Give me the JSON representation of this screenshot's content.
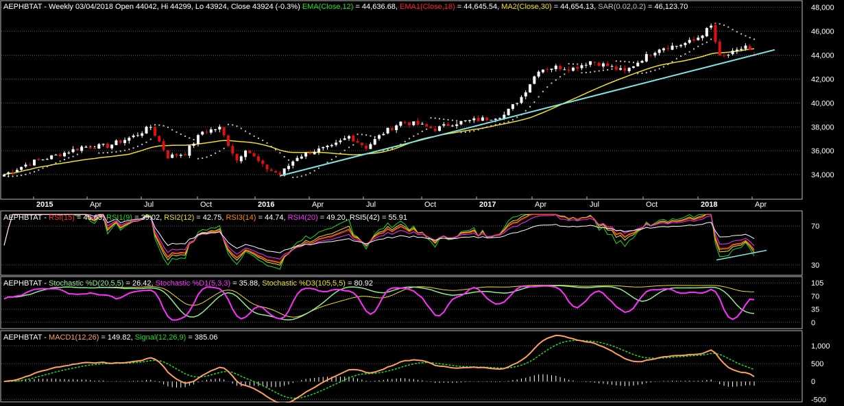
{
  "colors": {
    "background": "#000000",
    "border": "#bdbdbd",
    "grid": "#5a5a5a",
    "label": "#ffffff",
    "up_candle": "#ffffff",
    "down_candle": "#e01010",
    "ema": "#22dd22",
    "ema1": "#ff2020",
    "ma2": "#f0e020",
    "sar": "#c8c8c8",
    "trendline": "#7fe6e6",
    "rsi": "#ff3030",
    "rsi1": "#22dd22",
    "rsi2": "#f0e020",
    "rsi3": "#ff8c00",
    "rsi4": "#ff30ff",
    "rsi5": "#ffffff",
    "stoch_d": "#90ee90",
    "stoch_d1": "#ff30ff",
    "stoch_d3": "#f0e020",
    "macd": "#ffa060",
    "signal": "#22dd22",
    "histogram": "#ffffff"
  },
  "panels": {
    "price": {
      "symbol": "AEPHBTAT",
      "header_info": " - Weekly 03/04/2018 Open 44042, Hi 44299, Lo 43924, Close 43924 (-0.3%) ",
      "ind_ema_name": "EMA(Close,12)",
      "ind_ema_value": " = 44,636.68, ",
      "ind_ema1_name": "EMA1(Close,18)",
      "ind_ema1_value": " = 44,645.54, ",
      "ind_ma2_name": "MA2(Close,30)",
      "ind_ma2_value": " = 44,654.13, ",
      "ind_sar_name": "SAR(0.02,0.2)",
      "ind_sar_value": " = 46,123.70",
      "y_ticks": [
        "48,000",
        "46,000",
        "44,000",
        "42,000",
        "40,000",
        "38,000",
        "36,000",
        "34,000"
      ],
      "x_labels": [
        "2015",
        "Apr",
        "Jul",
        "Oct",
        "2016",
        "Apr",
        "Jul",
        "Oct",
        "2017",
        "Apr",
        "Jul",
        "Oct",
        "2018",
        "Apr"
      ]
    },
    "rsi": {
      "symbol": "AEPHBTAT",
      "sep": " - ",
      "ind_rsi_name": "RSI(15)",
      "ind_rsi_value": " = 45.63, ",
      "ind_rsi1_name": "RSI1(9)",
      "ind_rsi1_value": " = 39.02, ",
      "ind_rsi2_name": "RSI2(12)",
      "ind_rsi2_value": " = 42.75, ",
      "ind_rsi3_name": "RSI3(14)",
      "ind_rsi3_value": " = 44.74, ",
      "ind_rsi4_name": "RSI4(20)",
      "ind_rsi4_value": " = 49.20, ",
      "ind_rsi5_name": "RSI5(42)",
      "ind_rsi5_value": " = 55.91",
      "y_ticks": [
        "70",
        "30"
      ]
    },
    "stoch": {
      "symbol": "AEPHBTAT",
      "sep": " - ",
      "ind_d_name": "Stochastic %D(20,5,5)",
      "ind_d_value": " = 26.42, ",
      "ind_d1_name": "Stochastic %D1(5,3,3)",
      "ind_d1_value": " = 35.88, ",
      "ind_d3_name": "Stochastic %D3(105,5,5)",
      "ind_d3_value": " = 80.92",
      "y_ticks": [
        "105",
        "70",
        "35",
        "0"
      ]
    },
    "macd": {
      "symbol": "AEPHBTAT",
      "sep": " - ",
      "ind_macd_name": "MACD1(12,26)",
      "ind_macd_value": " = 149.82, ",
      "ind_signal_name": "Signal(12,26,9)",
      "ind_signal_value": " = 385.06",
      "y_ticks": [
        "1,000",
        "500",
        "0",
        "-500"
      ]
    }
  },
  "chart_data": [
    {
      "type": "candlestick",
      "title": "AEPHBTAT - Weekly",
      "ylim": [
        32000,
        48500
      ],
      "y_ticks": [
        34000,
        36000,
        38000,
        40000,
        42000,
        44000,
        46000,
        48000
      ],
      "x_labels": [
        "2015",
        "Apr",
        "Jul",
        "Oct",
        "2016",
        "Apr",
        "Jul",
        "Oct",
        "2017",
        "Apr",
        "Jul",
        "Oct",
        "2018",
        "Apr"
      ],
      "close_profile": [
        [
          0,
          34000
        ],
        [
          6,
          35000
        ],
        [
          12,
          35600
        ],
        [
          18,
          36300
        ],
        [
          24,
          36400
        ],
        [
          30,
          37200
        ],
        [
          34,
          38000
        ],
        [
          38,
          35500
        ],
        [
          42,
          35800
        ],
        [
          46,
          37600
        ],
        [
          50,
          37900
        ],
        [
          54,
          35200
        ],
        [
          56,
          36200
        ],
        [
          60,
          34700
        ],
        [
          64,
          34000
        ],
        [
          68,
          35500
        ],
        [
          72,
          36000
        ],
        [
          76,
          36300
        ],
        [
          80,
          37200
        ],
        [
          84,
          36300
        ],
        [
          88,
          37500
        ],
        [
          92,
          38400
        ],
        [
          96,
          38200
        ],
        [
          100,
          37800
        ],
        [
          104,
          38300
        ],
        [
          108,
          38500
        ],
        [
          112,
          38700
        ],
        [
          116,
          39000
        ],
        [
          120,
          40500
        ],
        [
          124,
          42800
        ],
        [
          128,
          43000
        ],
        [
          132,
          42900
        ],
        [
          136,
          43500
        ],
        [
          140,
          43100
        ],
        [
          144,
          42600
        ],
        [
          148,
          43700
        ],
        [
          152,
          44600
        ],
        [
          156,
          44800
        ],
        [
          160,
          45200
        ],
        [
          164,
          46400
        ],
        [
          166,
          43800
        ],
        [
          170,
          44300
        ],
        [
          172,
          44800
        ],
        [
          174,
          43924
        ]
      ],
      "series": [
        {
          "name": "EMA(Close,12)",
          "last": 44636.68
        },
        {
          "name": "EMA1(Close,18)",
          "last": 44645.54
        },
        {
          "name": "MA2(Close,30)",
          "last": 44654.13
        },
        {
          "name": "SAR(0.02,0.2)",
          "last": 46123.7
        }
      ],
      "last_bar": {
        "date": "03/04/2018",
        "open": 44042,
        "high": 44299,
        "low": 43924,
        "close": 43924,
        "change_pct": -0.3
      }
    },
    {
      "type": "line",
      "title": "RSI",
      "ylim": [
        20,
        85
      ],
      "y_ticks": [
        30,
        70
      ],
      "series": [
        {
          "name": "RSI(15)",
          "last": 45.63
        },
        {
          "name": "RSI1(9)",
          "last": 39.02
        },
        {
          "name": "RSI2(12)",
          "last": 42.75
        },
        {
          "name": "RSI3(14)",
          "last": 44.74
        },
        {
          "name": "RSI4(20)",
          "last": 49.2
        },
        {
          "name": "RSI5(42)",
          "last": 55.91
        }
      ]
    },
    {
      "type": "line",
      "title": "Stochastic",
      "ylim": [
        -15,
        120
      ],
      "y_ticks": [
        0,
        35,
        70,
        105
      ],
      "series": [
        {
          "name": "Stochastic %D(20,5,5)",
          "last": 26.42
        },
        {
          "name": "Stochastic %D1(5,3,3)",
          "last": 35.88
        },
        {
          "name": "Stochastic %D3(105,5,5)",
          "last": 80.92
        }
      ]
    },
    {
      "type": "line",
      "title": "MACD",
      "ylim": [
        -550,
        1400
      ],
      "y_ticks": [
        -500,
        0,
        500,
        1000
      ],
      "series": [
        {
          "name": "MACD1(12,26)",
          "last": 149.82
        },
        {
          "name": "Signal(12,26,9)",
          "last": 385.06
        }
      ]
    }
  ]
}
